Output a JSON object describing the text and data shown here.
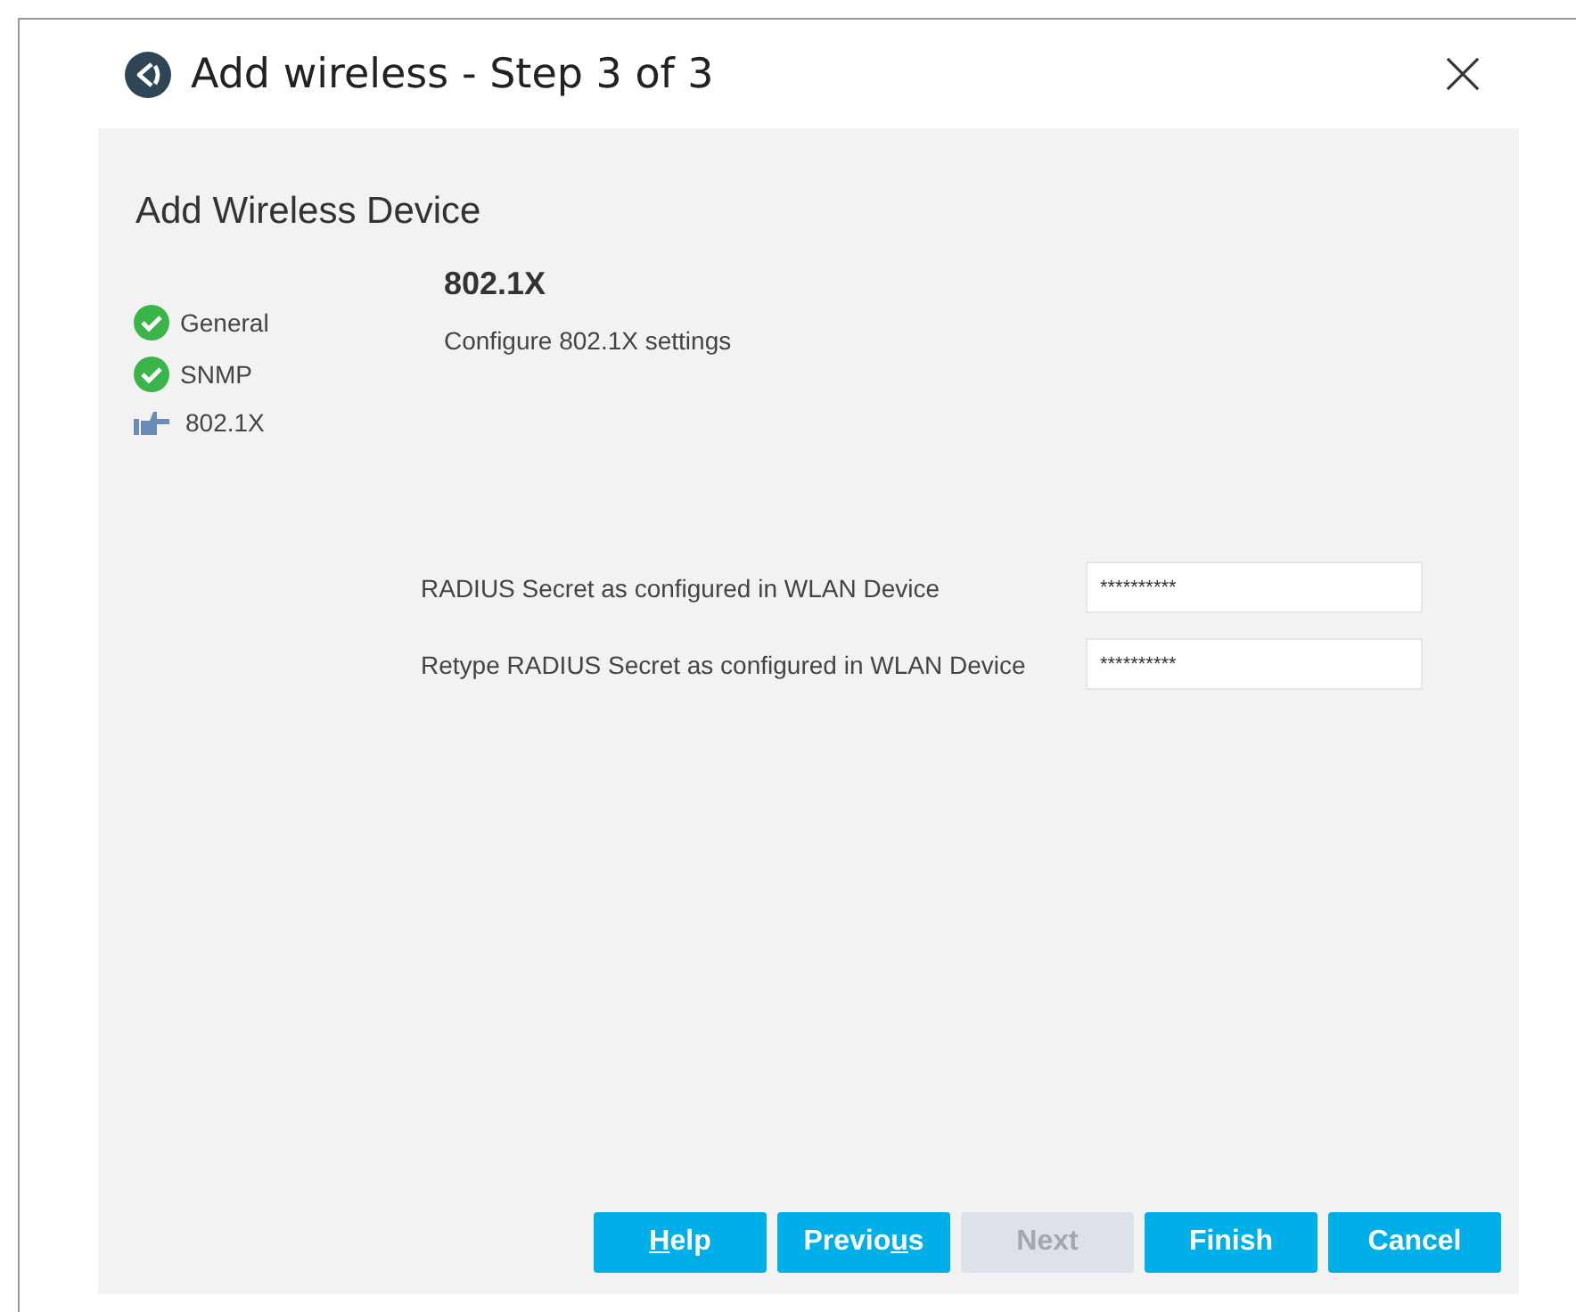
{
  "window": {
    "title": "Add wireless - Step 3 of 3"
  },
  "heading": "Add Wireless Device",
  "steps": [
    {
      "label": "General",
      "kind": "done"
    },
    {
      "label": "SNMP",
      "kind": "done"
    },
    {
      "label": "802.1X",
      "kind": "current"
    }
  ],
  "section": {
    "title": "802.1X",
    "subtitle": "Configure 802.1X settings"
  },
  "fields": [
    {
      "label": "RADIUS Secret as configured in WLAN Device",
      "value": "**********"
    },
    {
      "label": "Retype RADIUS Secret as configured in WLAN Device",
      "value": "**********"
    }
  ],
  "buttons": [
    {
      "key": "H",
      "after": "elp",
      "disabled": false
    },
    {
      "before": "Previo",
      "key": "u",
      "after": "s",
      "disabled": false
    },
    {
      "before": "Next",
      "disabled": true
    },
    {
      "before": "Finish",
      "disabled": false
    },
    {
      "before": "Cancel",
      "disabled": false
    }
  ]
}
